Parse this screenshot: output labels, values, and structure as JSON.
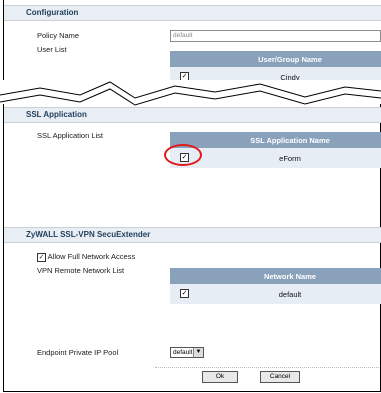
{
  "configuration": {
    "title": "Configuration",
    "policy_name_label": "Policy Name",
    "policy_name_value": "default",
    "user_list_label": "User List",
    "user_table": {
      "header": "User/Group Name",
      "rows": [
        {
          "checked": true,
          "check_mark": "✓",
          "name": "Cindy"
        }
      ]
    }
  },
  "ssl_application": {
    "title": "SSL Application",
    "list_label": "SSL Application List",
    "table": {
      "header": "SSL Application Name",
      "rows": [
        {
          "checked": true,
          "check_mark": "✓",
          "name": "eForm"
        }
      ]
    }
  },
  "secuextender": {
    "title": "ZyWALL SSL-VPN SecuExtender",
    "allow_full_label": "Allow Full Network Access",
    "allow_full_mark": "✓",
    "remote_list_label": "VPN Remote Network List",
    "table": {
      "header": "Network Name",
      "rows": [
        {
          "checked": true,
          "check_mark": "✓",
          "name": "default"
        }
      ]
    },
    "endpoint_label": "Endpoint Private IP Pool",
    "endpoint_value": "default",
    "dropdown_arrow": "▼"
  },
  "buttons": {
    "ok": "Ok",
    "cancel": "Cancel"
  },
  "colors": {
    "table_header": "#8aa1bb",
    "section_header": "#e9eef4",
    "highlight": "#e01818"
  }
}
